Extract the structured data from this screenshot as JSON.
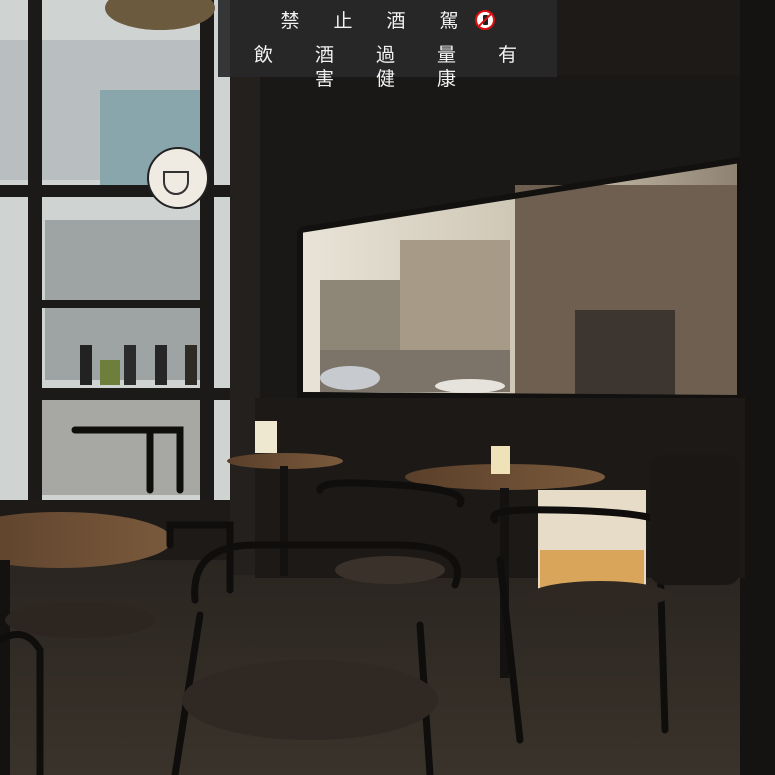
{
  "banner": {
    "line1": "禁 止 酒 駕",
    "line2": "飲 酒 過 量 有 害 健 康",
    "icon": "no-drinking-icon",
    "icon_color": "#d11111"
  },
  "scene": {
    "description_tags": [
      "cafe-interior",
      "window",
      "tables",
      "chairs"
    ]
  }
}
